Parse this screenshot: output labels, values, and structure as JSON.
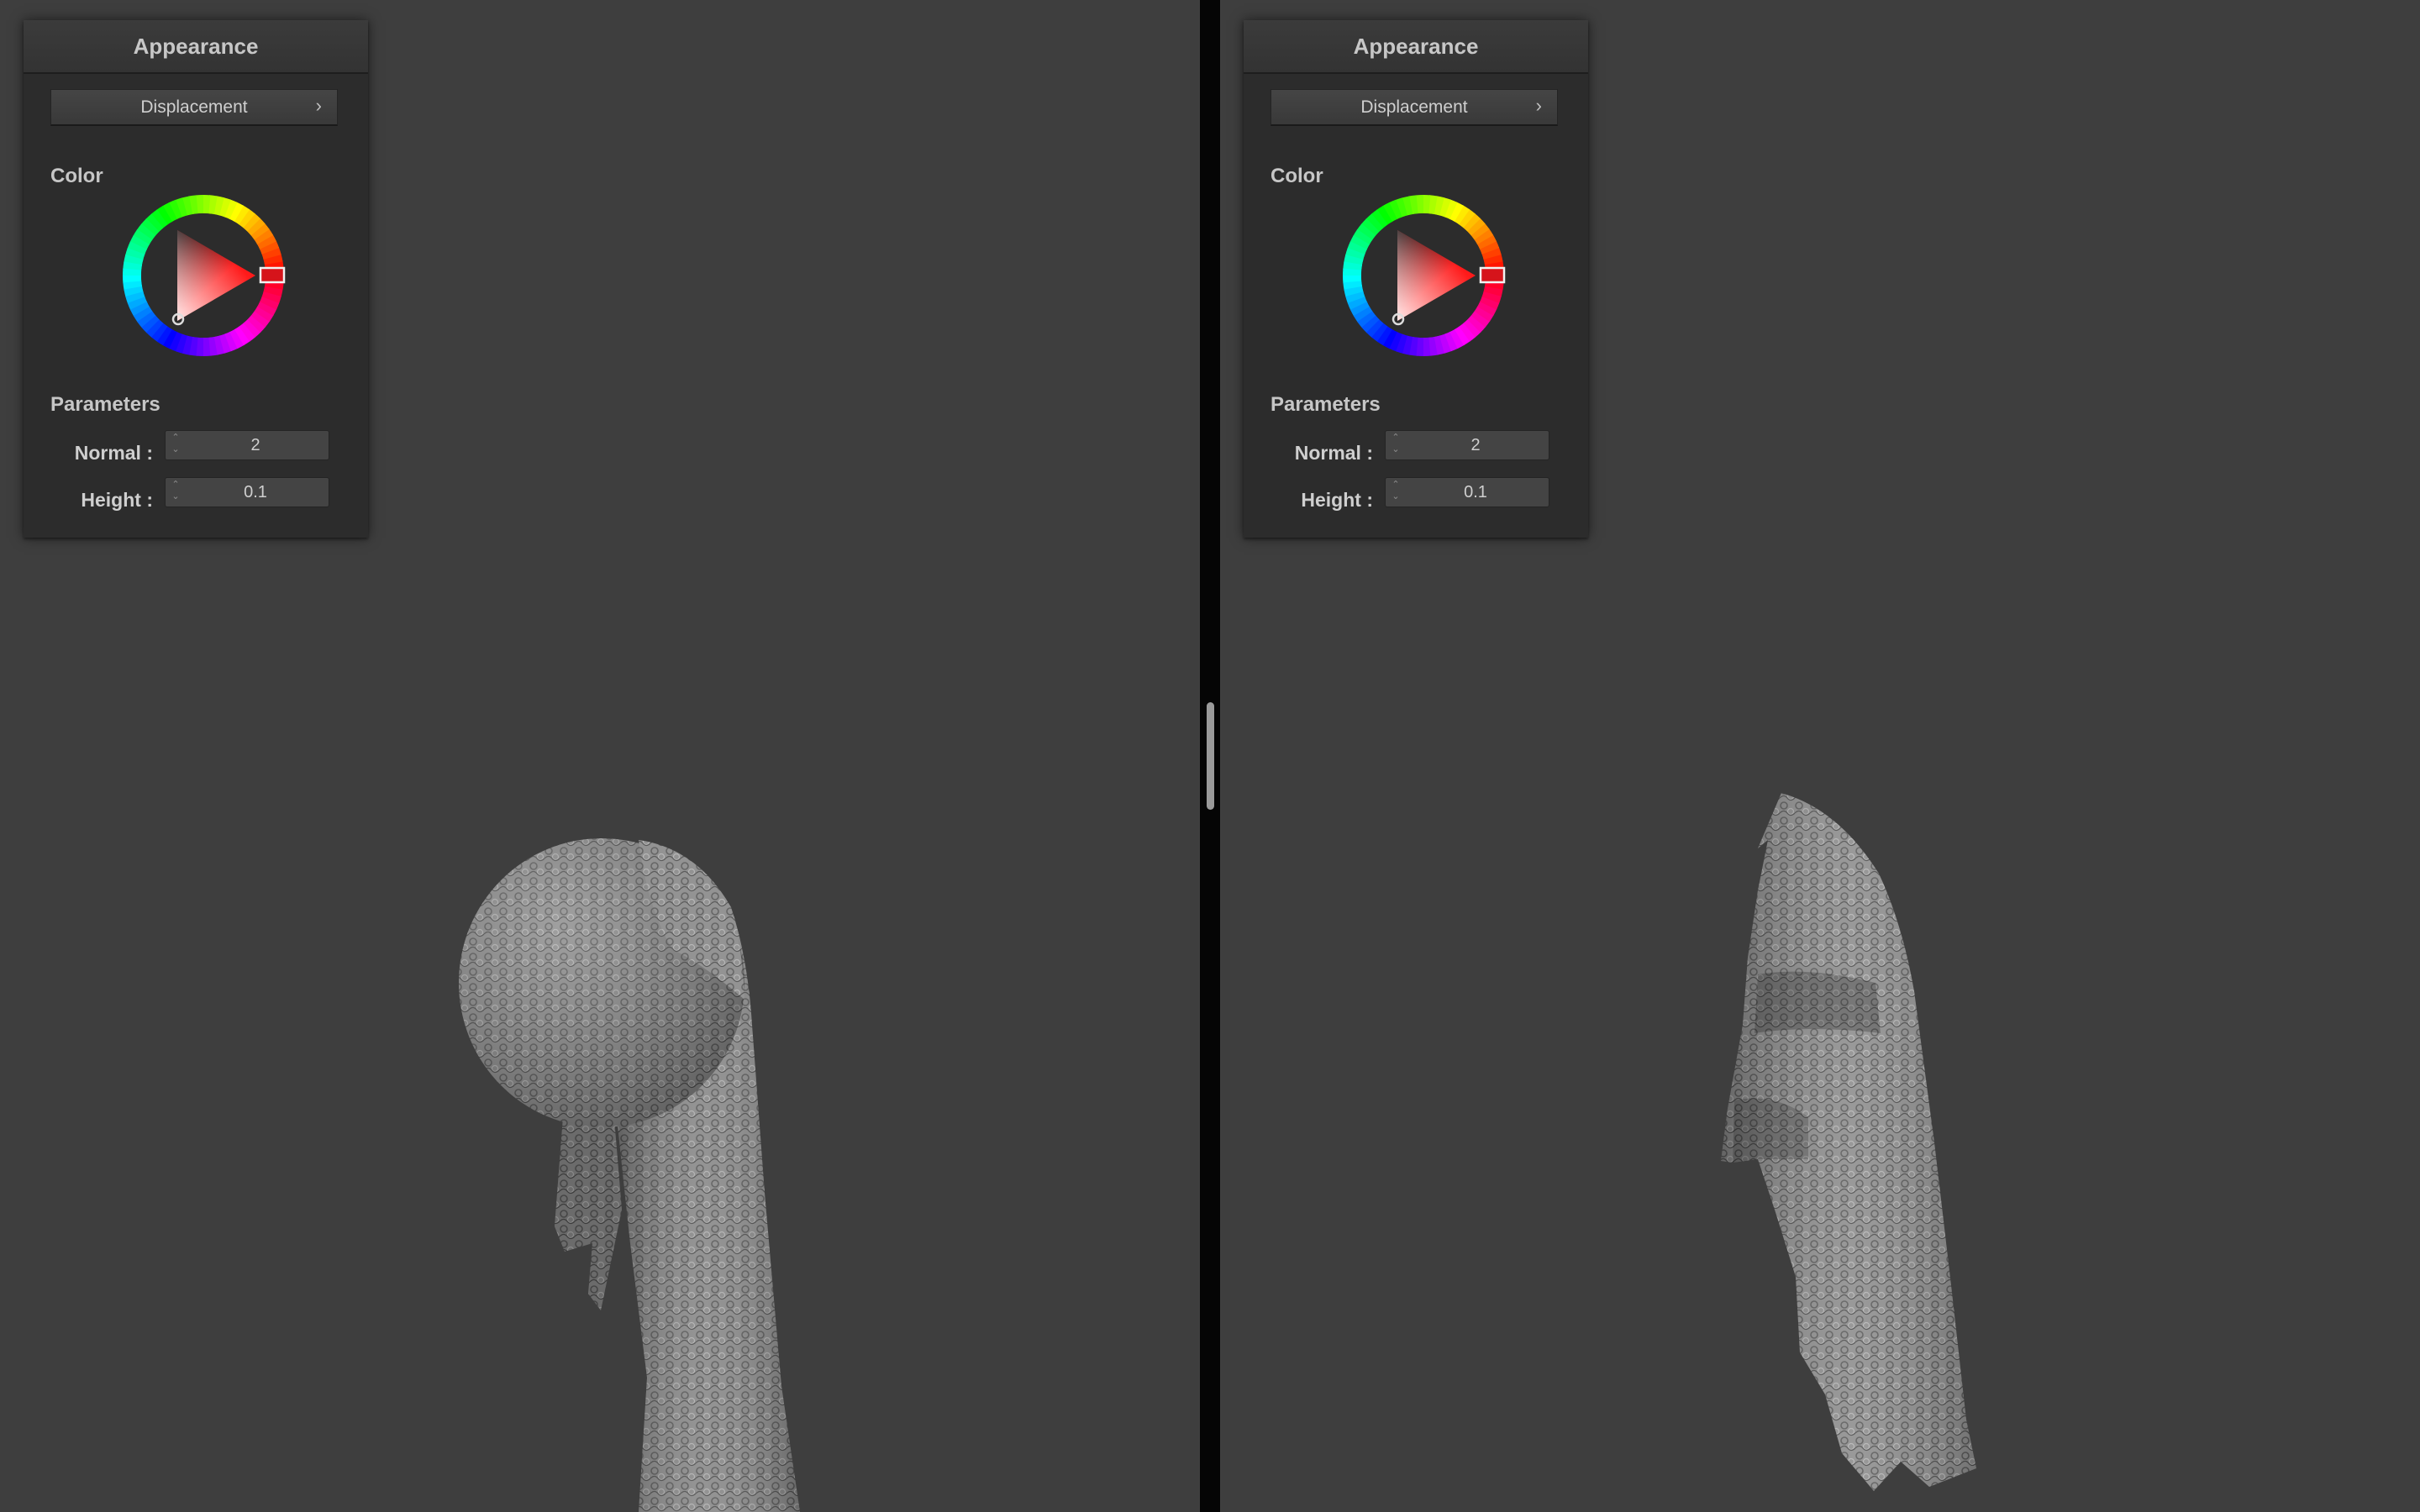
{
  "panels": [
    {
      "header_title": "Appearance",
      "dropdown_label": "Displacement",
      "color_label": "Color",
      "parameters_label": "Parameters",
      "params": [
        {
          "label": "Normal :",
          "value": "2"
        },
        {
          "label": "Height :",
          "value": "0.1"
        }
      ]
    },
    {
      "header_title": "Appearance",
      "dropdown_label": "Displacement",
      "color_label": "Color",
      "parameters_label": "Parameters",
      "params": [
        {
          "label": "Normal :",
          "value": "2"
        },
        {
          "label": "Height :",
          "value": "0.1"
        }
      ]
    }
  ],
  "colors": {
    "viewport_bg": "#3e3e3e",
    "panel_bg": "#2c2c2c",
    "selected_hue": "#ff1a1a",
    "divider": "#050505"
  },
  "icons": {
    "dropdown": "chevron-right-icon",
    "spinbox": "up-down-arrows-icon"
  }
}
